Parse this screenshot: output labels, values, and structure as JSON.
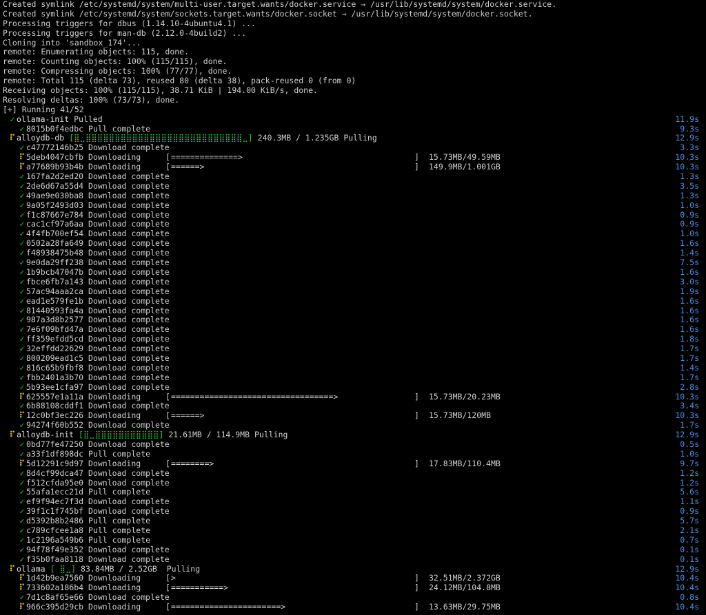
{
  "colors": {
    "background": "#000000",
    "text": "#d0d0d0",
    "done": "#22c93c",
    "active": "#e8c61b",
    "timer": "#4f8fe6"
  },
  "icons": {
    "done": "check-icon",
    "active": "spinner-icon"
  },
  "glyphs": {
    "check": "✓",
    "spin": "⠏"
  },
  "plain_lines": [
    "Created symlink /etc/systemd/system/multi-user.target.wants/docker.service → /usr/lib/systemd/system/docker.service.",
    "Created symlink /etc/systemd/system/sockets.target.wants/docker.socket → /usr/lib/systemd/system/docker.socket.",
    "Processing triggers for dbus (1.14.10-4ubuntu4.1) ...",
    "Processing triggers for man-db (2.12.0-4build2) ...",
    "Cloning into 'sandbox_174'...",
    "remote: Enumerating objects: 115, done.",
    "remote: Counting objects: 100% (115/115), done.",
    "remote: Compressing objects: 100% (77/77), done.",
    "remote: Total 115 (delta 73), reused 80 (delta 38), pack-reused 0 (from 0)",
    "Receiving objects: 100% (115/115), 38.71 KiB | 194.00 KiB/s, done.",
    "Resolving deltas: 100% (73/73), done.",
    "[+] Running 41/52"
  ],
  "entries": [
    {
      "kind": "svc",
      "state": "done",
      "name": "ollama-init",
      "status": "Pulled",
      "time": "11.9s"
    },
    {
      "kind": "layer",
      "state": "done",
      "id": "8015b0f4edbc",
      "status": "Pull complete",
      "time": "9.3s"
    },
    {
      "kind": "svc",
      "state": "active",
      "name": "alloydb-db",
      "bar": "[⣿⣀⣿⣿⣿⣿⣿⣿⣿⣿⣿⣿⣿⣿⣿⣿⣿⣿⣿⣿⣿⣿⣿⣿⣿⣿⣿⣿⣿⣀]",
      "sizes": "240.3MB / 1.235GB",
      "status": "Pulling",
      "time": "12.9s"
    },
    {
      "kind": "layer",
      "state": "done",
      "id": "c47772146b25",
      "status": "Download complete",
      "time": "3.3s"
    },
    {
      "kind": "layer",
      "state": "active",
      "id": "5deb4047cbfb",
      "status": "Downloading",
      "progress": "==============>",
      "size": "15.73MB/49.59MB",
      "time": "10.3s"
    },
    {
      "kind": "layer",
      "state": "active",
      "id": "a77689b93b4b",
      "status": "Downloading",
      "progress": "======>",
      "size": "149.9MB/1.001GB",
      "time": "10.3s"
    },
    {
      "kind": "layer",
      "state": "done",
      "id": "167fa2d2ed20",
      "status": "Download complete",
      "time": "1.3s"
    },
    {
      "kind": "layer",
      "state": "done",
      "id": "2de6d67a55d4",
      "status": "Download complete",
      "time": "3.5s"
    },
    {
      "kind": "layer",
      "state": "done",
      "id": "49ae9e030ba8",
      "status": "Download complete",
      "time": "1.3s"
    },
    {
      "kind": "layer",
      "state": "done",
      "id": "9a05f2493d03",
      "status": "Download complete",
      "time": "1.0s"
    },
    {
      "kind": "layer",
      "state": "done",
      "id": "f1c87667e784",
      "status": "Download complete",
      "time": "0.9s"
    },
    {
      "kind": "layer",
      "state": "done",
      "id": "cac1cf97a6aa",
      "status": "Download complete",
      "time": "0.9s"
    },
    {
      "kind": "layer",
      "state": "done",
      "id": "4f4fb700ef54",
      "status": "Download complete",
      "time": "1.0s"
    },
    {
      "kind": "layer",
      "state": "done",
      "id": "0502a28fa649",
      "status": "Download complete",
      "time": "1.6s"
    },
    {
      "kind": "layer",
      "state": "done",
      "id": "f48938475b48",
      "status": "Download complete",
      "time": "1.4s"
    },
    {
      "kind": "layer",
      "state": "done",
      "id": "9e0da29ff238",
      "status": "Download complete",
      "time": "7.5s"
    },
    {
      "kind": "layer",
      "state": "done",
      "id": "1b9bcb47047b",
      "status": "Download complete",
      "time": "1.6s"
    },
    {
      "kind": "layer",
      "state": "done",
      "id": "fbce6fb7a143",
      "status": "Download complete",
      "time": "3.0s"
    },
    {
      "kind": "layer",
      "state": "done",
      "id": "57ac94aaa2ca",
      "status": "Download complete",
      "time": "1.9s"
    },
    {
      "kind": "layer",
      "state": "done",
      "id": "ead1e579fe1b",
      "status": "Download complete",
      "time": "1.6s"
    },
    {
      "kind": "layer",
      "state": "done",
      "id": "81440593fa4a",
      "status": "Download complete",
      "time": "1.6s"
    },
    {
      "kind": "layer",
      "state": "done",
      "id": "987a3d8b2577",
      "status": "Download complete",
      "time": "1.6s"
    },
    {
      "kind": "layer",
      "state": "done",
      "id": "7e6f09bfd47a",
      "status": "Download complete",
      "time": "1.6s"
    },
    {
      "kind": "layer",
      "state": "done",
      "id": "ff359efdd5cd",
      "status": "Download complete",
      "time": "1.8s"
    },
    {
      "kind": "layer",
      "state": "done",
      "id": "32effdd22629",
      "status": "Download complete",
      "time": "1.7s"
    },
    {
      "kind": "layer",
      "state": "done",
      "id": "800209ead1c5",
      "status": "Download complete",
      "time": "1.7s"
    },
    {
      "kind": "layer",
      "state": "done",
      "id": "816c65b9fbf8",
      "status": "Download complete",
      "time": "1.4s"
    },
    {
      "kind": "layer",
      "state": "done",
      "id": "fbb2401a3b70",
      "status": "Download complete",
      "time": "1.7s"
    },
    {
      "kind": "layer",
      "state": "done",
      "id": "5b93ee1cfa97",
      "status": "Download complete",
      "time": "2.8s"
    },
    {
      "kind": "layer",
      "state": "active",
      "id": "625557e1a11a",
      "status": "Downloading",
      "progress": "==================================>",
      "size": "15.73MB/20.23MB",
      "time": "10.3s"
    },
    {
      "kind": "layer",
      "state": "done",
      "id": "6b88108cddf1",
      "status": "Download complete",
      "time": "3.4s"
    },
    {
      "kind": "layer",
      "state": "active",
      "id": "12c0bf3ec226",
      "status": "Downloading",
      "progress": "======>",
      "size": "15.73MB/120MB",
      "time": "10.3s"
    },
    {
      "kind": "layer",
      "state": "done",
      "id": "94274f60b552",
      "status": "Download complete",
      "time": "1.7s"
    },
    {
      "kind": "svc",
      "state": "active",
      "name": "alloydb-init",
      "bar": "[⣿⣀⣿⣿⣿⣿⣿⣿⣿⣿⣿⣿⣿]",
      "sizes": "21.61MB / 114.9MB",
      "status": "Pulling",
      "time": "12.9s"
    },
    {
      "kind": "layer",
      "state": "done",
      "id": "0bd77fe47250",
      "status": "Download complete",
      "time": "0.5s"
    },
    {
      "kind": "layer",
      "state": "done",
      "id": "a33f1df898dc",
      "status": "Pull complete",
      "time": "1.0s"
    },
    {
      "kind": "layer",
      "state": "active",
      "id": "5d12291c9d97",
      "status": "Downloading",
      "progress": "========>",
      "size": "17.83MB/110.4MB",
      "time": "9.7s"
    },
    {
      "kind": "layer",
      "state": "done",
      "id": "8d4cf99dca47",
      "status": "Download complete",
      "time": "1.2s"
    },
    {
      "kind": "layer",
      "state": "done",
      "id": "f512cfda95e0",
      "status": "Download complete",
      "time": "1.2s"
    },
    {
      "kind": "layer",
      "state": "done",
      "id": "55afa1ecc21d",
      "status": "Pull complete",
      "time": "5.6s"
    },
    {
      "kind": "layer",
      "state": "done",
      "id": "ef9f94ec7f3d",
      "status": "Download complete",
      "time": "1.1s"
    },
    {
      "kind": "layer",
      "state": "done",
      "id": "39f1c1f745bf",
      "status": "Download complete",
      "time": "0.9s"
    },
    {
      "kind": "layer",
      "state": "done",
      "id": "d5392b8b2486",
      "status": "Pull complete",
      "time": "5.7s"
    },
    {
      "kind": "layer",
      "state": "done",
      "id": "c789cfcee1a8",
      "status": "Pull complete",
      "time": "2.1s"
    },
    {
      "kind": "layer",
      "state": "done",
      "id": "1c2196a549b6",
      "status": "Pull complete",
      "time": "0.7s"
    },
    {
      "kind": "layer",
      "state": "done",
      "id": "94f78f49e352",
      "status": "Download complete",
      "time": "0.1s"
    },
    {
      "kind": "layer",
      "state": "done",
      "id": "f35b0faa8118",
      "status": "Download complete",
      "time": "0.1s"
    },
    {
      "kind": "svc",
      "state": "active",
      "name": "ollama",
      "bar": "[ ⣿⣀]",
      "sizes": "83.84MB / 2.52GB",
      "status": " Pulling",
      "time": "12.9s"
    },
    {
      "kind": "layer",
      "state": "active",
      "id": "1d42b9ea7560",
      "status": "Downloading",
      "progress": ">",
      "size": "32.51MB/2.372GB",
      "time": "10.4s"
    },
    {
      "kind": "layer",
      "state": "active",
      "id": "733602a186b4",
      "status": "Downloading",
      "progress": "===========>",
      "size": "24.12MB/104.8MB",
      "time": "10.4s"
    },
    {
      "kind": "layer",
      "state": "done",
      "id": "7d1c8af65e66",
      "status": "Download complete",
      "time": "0.8s"
    },
    {
      "kind": "layer",
      "state": "active",
      "id": "966c395d29cb",
      "status": "Downloading",
      "progress": "=======================>",
      "size": "13.63MB/29.75MB",
      "time": "10.4s"
    }
  ]
}
